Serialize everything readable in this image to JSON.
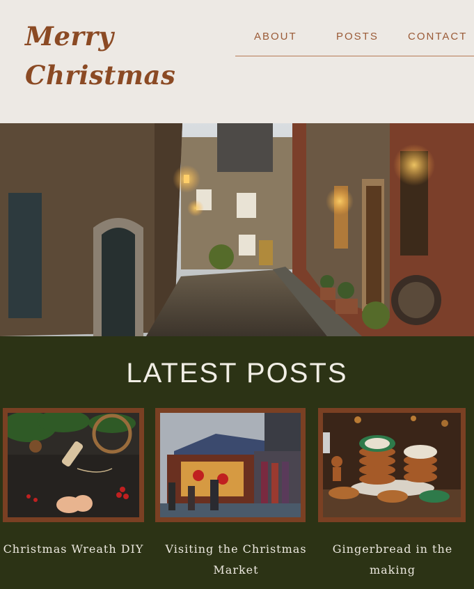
{
  "site": {
    "logo_line1": "Merry",
    "logo_line2": "Christmas"
  },
  "nav": [
    {
      "label": "ABOUT"
    },
    {
      "label": "POSTS"
    },
    {
      "label": "CONTACT"
    }
  ],
  "colors": {
    "header_bg": "#ede9e4",
    "brand_brown": "#8b4a24",
    "section_bg": "#2c3315",
    "frame": "#7a4023"
  },
  "latest": {
    "heading": "LATEST POSTS",
    "posts": [
      {
        "title": "Christmas Wreath DIY"
      },
      {
        "title": "Visiting the Christmas Market"
      },
      {
        "title": "Gingerbread in the making"
      }
    ]
  }
}
